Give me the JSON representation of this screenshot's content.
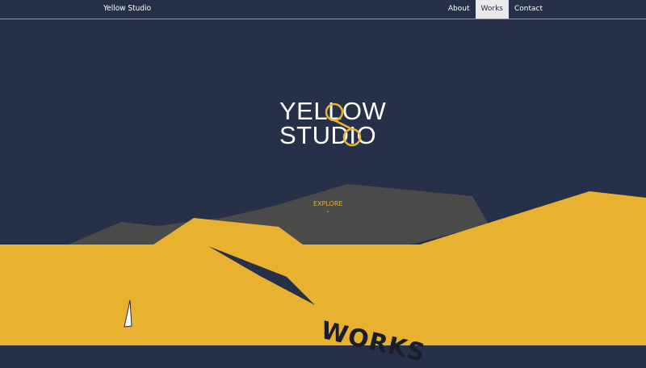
{
  "nav": {
    "brand": "Yellow Studio",
    "links": [
      {
        "label": "About",
        "active": false
      },
      {
        "label": "Works",
        "active": true
      },
      {
        "label": "Contact",
        "active": false
      }
    ]
  },
  "hero": {
    "logo_line1": "YELLOW",
    "logo_line2": "STUDIO",
    "explore_label": "EXPLORE",
    "explore_arrow": "⌄"
  },
  "section": {
    "works_title": "WORKS"
  },
  "colors": {
    "navy": "#263048",
    "yellow": "#e8b130",
    "gray": "#4a4a49",
    "white": "#ffffff"
  }
}
